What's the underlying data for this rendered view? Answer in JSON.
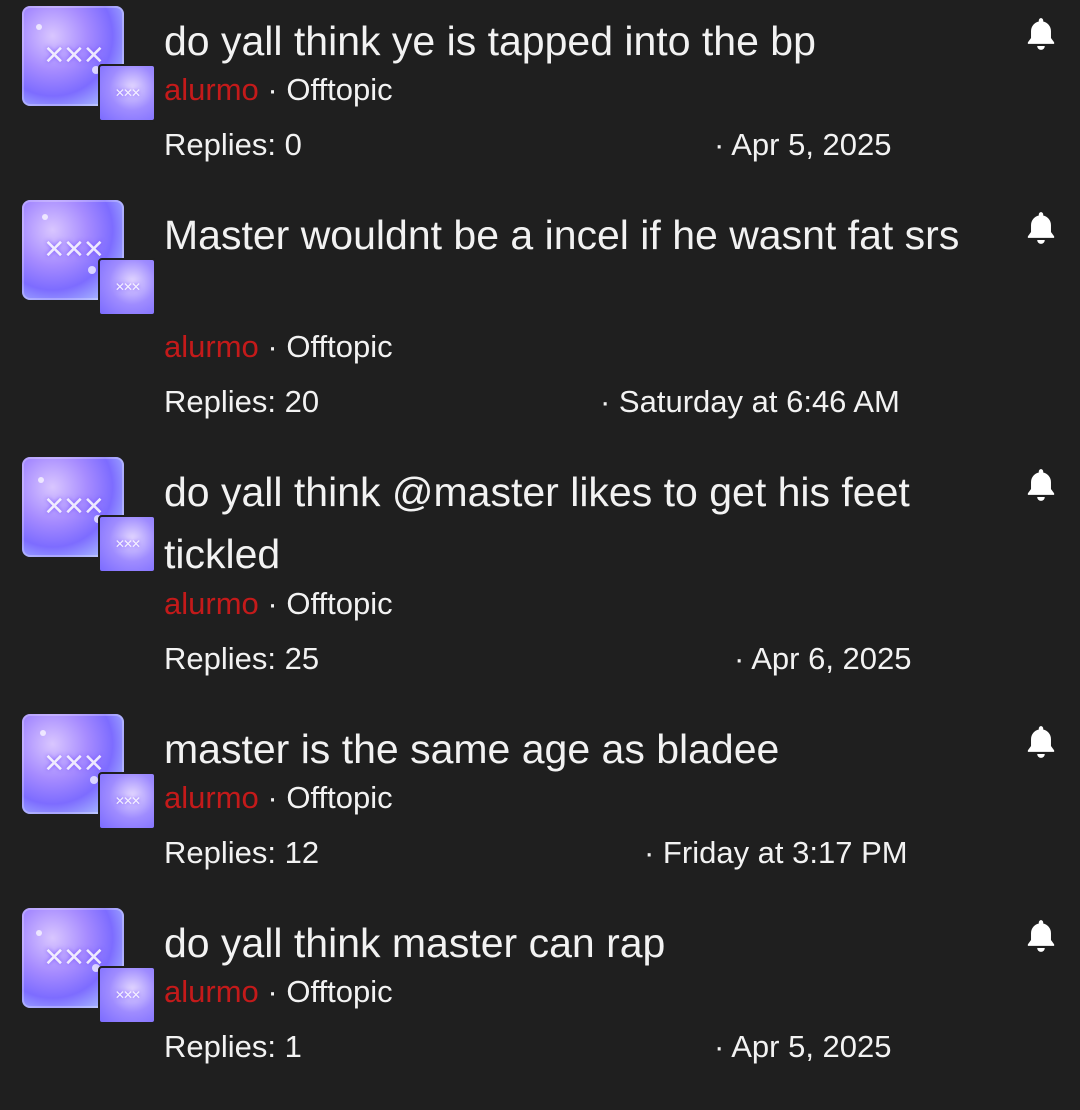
{
  "threads": [
    {
      "title": "do yall think ye is tapped into the bp",
      "author": "alurmo",
      "separator": "·",
      "forum": "Offtopic",
      "replies": "Replies: 0",
      "date": "· Apr 5, 2025"
    },
    {
      "title": "Master wouldnt be a incel if he wasnt fat srs",
      "author": "alurmo",
      "separator": "·",
      "forum": "Offtopic",
      "replies": "Replies: 20",
      "date": "· Saturday at 6:46 AM"
    },
    {
      "title": "do yall think @master likes to get his feet tickled",
      "author": "alurmo",
      "separator": "·",
      "forum": "Offtopic",
      "replies": "Replies: 25",
      "date": "· Apr 6, 2025"
    },
    {
      "title": "master is the same age as bladee",
      "author": "alurmo",
      "separator": "·",
      "forum": "Offtopic",
      "replies": "Replies: 12",
      "date": "· Friday at 3:17 PM"
    },
    {
      "title": "do yall think master can rap",
      "author": "alurmo",
      "separator": "·",
      "forum": "Offtopic",
      "replies": "Replies: 1",
      "date": "· Apr 5, 2025"
    }
  ],
  "icons": {
    "watch": "bell-icon",
    "avatar": "avatar"
  },
  "colors": {
    "background": "#1f1f1f",
    "text": "#f2f2f2",
    "author": "#c41a1a"
  }
}
